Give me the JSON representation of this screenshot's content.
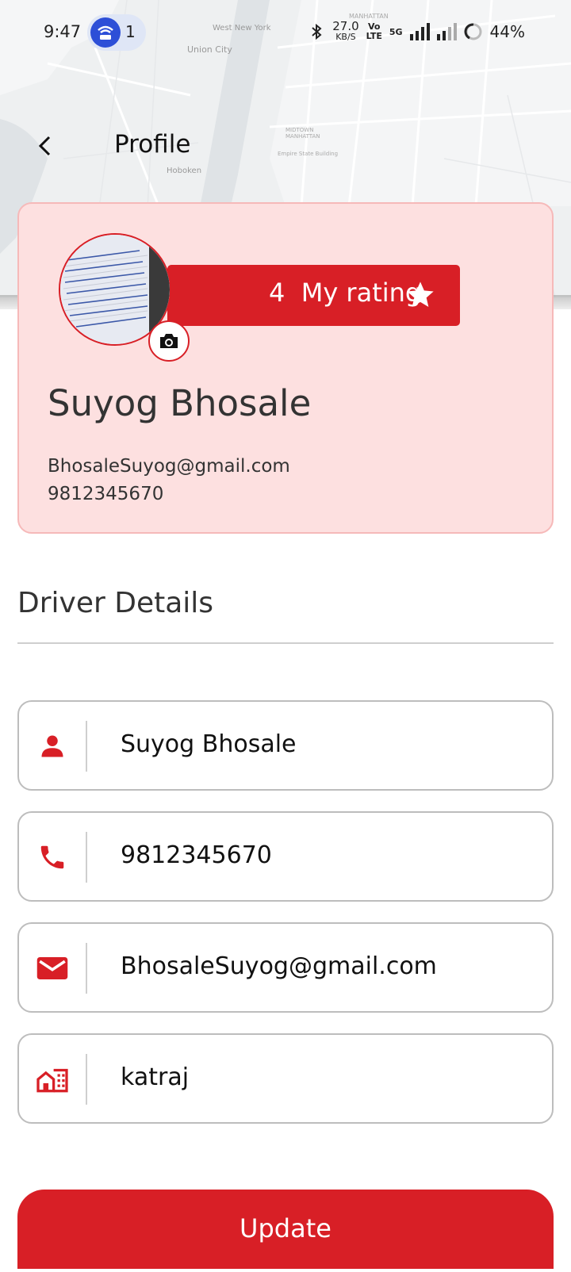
{
  "status_bar": {
    "time": "9:47",
    "hotspot_count": "1",
    "speed_value": "27.0",
    "speed_unit": "KB/S",
    "volte_top": "Vo",
    "volte_bottom": "LTE",
    "network_type": "5G",
    "battery": "44%"
  },
  "map_labels": {
    "west_new_york": "West New York",
    "union_city": "Union City",
    "manhattan": "MANHATTAN",
    "hoboken": "Hoboken",
    "empire_state": "Empire State Building",
    "midtown": "MIDTOWN MANHATTAN"
  },
  "header": {
    "title": "Profile"
  },
  "profile_card": {
    "rating_value": "4",
    "rating_label": "My rating",
    "name": "Suyog Bhosale",
    "email": "BhosaleSuyog@gmail.com",
    "phone": "9812345670"
  },
  "section": {
    "title": "Driver Details"
  },
  "fields": {
    "name": "Suyog Bhosale",
    "phone": "9812345670",
    "email": "BhosaleSuyog@gmail.com",
    "address": "katraj"
  },
  "update_button": {
    "label": "Update"
  },
  "colors": {
    "accent": "#d81f26",
    "card_bg": "#fde0e0",
    "card_border": "#f6b9b9"
  },
  "icons": {
    "back": "chevron-left-icon",
    "camera": "camera-icon",
    "star": "star-icon",
    "person": "person-icon",
    "phone": "phone-icon",
    "email": "mail-icon",
    "address": "home-city-icon"
  }
}
